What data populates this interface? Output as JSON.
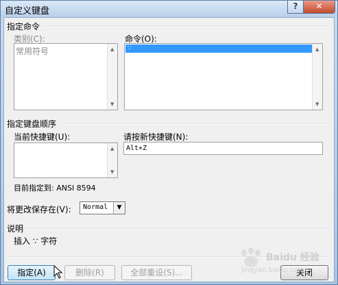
{
  "window": {
    "title": "自定义键盘",
    "help_glyph": "?",
    "close_glyph": "✕"
  },
  "assign": {
    "group_label": "指定命令",
    "categories_label": "类别(C):",
    "categories": [
      "常用符号"
    ],
    "commands_label": "命令(O):",
    "commands": [
      "∵"
    ]
  },
  "sequence": {
    "group_label": "指定键盘顺序",
    "current_keys_label": "当前快捷键(U):",
    "new_key_label": "请按新快捷键(N):",
    "new_key_value": "Alt+Z",
    "assigned_to": "目前指定到:  ANSI 8594"
  },
  "save_in": {
    "label": "将更改保存在(V):",
    "value": "Normal"
  },
  "description": {
    "group_label": "说明",
    "text": "插入 ∵ 字符"
  },
  "buttons": {
    "assign": "指定(A)",
    "remove": "删除(R)",
    "reset_all": "全部重设(S)...",
    "close": "关闭"
  },
  "watermark": {
    "line1": "Baidu 经验",
    "line2": "jingyan.baidu.com"
  }
}
